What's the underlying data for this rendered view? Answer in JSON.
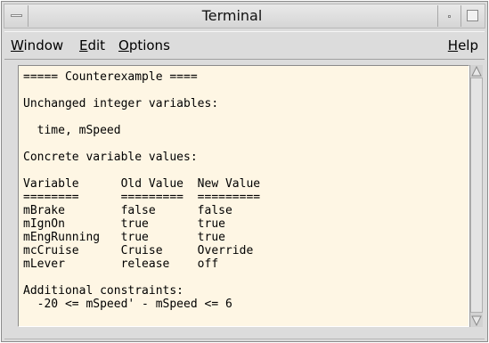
{
  "window": {
    "title": "Terminal"
  },
  "menubar": {
    "window": {
      "mnemonic": "W",
      "rest": "indow"
    },
    "edit": {
      "mnemonic": "E",
      "rest": "dit"
    },
    "options": {
      "mnemonic": "O",
      "rest": "ptions"
    },
    "help": {
      "mnemonic": "H",
      "rest": "elp"
    }
  },
  "terminal": {
    "lines": [
      "===== Counterexample ====",
      "",
      "Unchanged integer variables:",
      "",
      "  time, mSpeed",
      "",
      "Concrete variable values:",
      "",
      "Variable      Old Value  New Value",
      "========      =========  =========",
      "mBrake        false      false",
      "mIgnOn        true       true",
      "mEngRunning   true       true",
      "mcCruise      Cruise     Override",
      "mLever        release    off",
      "",
      "Additional constraints:",
      "  -20 <= mSpeed' - mSpeed <= 6"
    ]
  },
  "icons": {
    "window_menu": "window-menu-icon",
    "minimize": "minimize-icon",
    "maximize": "maximize-icon",
    "scroll_up": "scroll-up-arrow-icon",
    "scroll_down": "scroll-down-arrow-icon"
  },
  "colors": {
    "terminal_background": "#fef6e4",
    "chrome": "#dcdcdc"
  }
}
